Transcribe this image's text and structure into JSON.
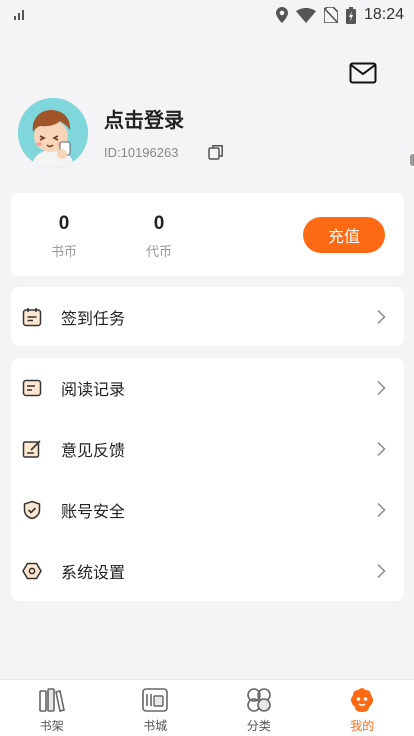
{
  "status_bar": {
    "time": "18:24"
  },
  "profile": {
    "username": "点击登录",
    "user_id": "ID:10196263"
  },
  "wallet": {
    "coins_value": "0",
    "coins_label": "书币",
    "vouchers_value": "0",
    "vouchers_label": "代币",
    "recharge_label": "充值"
  },
  "checkin": {
    "label": "签到任务"
  },
  "menu": {
    "items": [
      {
        "label": "阅读记录",
        "icon": "history-icon"
      },
      {
        "label": "意见反馈",
        "icon": "feedback-icon"
      },
      {
        "label": "账号安全",
        "icon": "shield-icon"
      },
      {
        "label": "系统设置",
        "icon": "settings-icon"
      }
    ]
  },
  "tabbar": {
    "tabs": [
      {
        "label": "书架",
        "icon": "bookshelf-icon",
        "active": false
      },
      {
        "label": "书城",
        "icon": "bookstore-icon",
        "active": false
      },
      {
        "label": "分类",
        "icon": "category-icon",
        "active": false
      },
      {
        "label": "我的",
        "icon": "profile-icon",
        "active": true
      }
    ]
  },
  "colors": {
    "accent": "#fe6a14",
    "background": "#f4f4f6",
    "card": "#ffffff"
  }
}
